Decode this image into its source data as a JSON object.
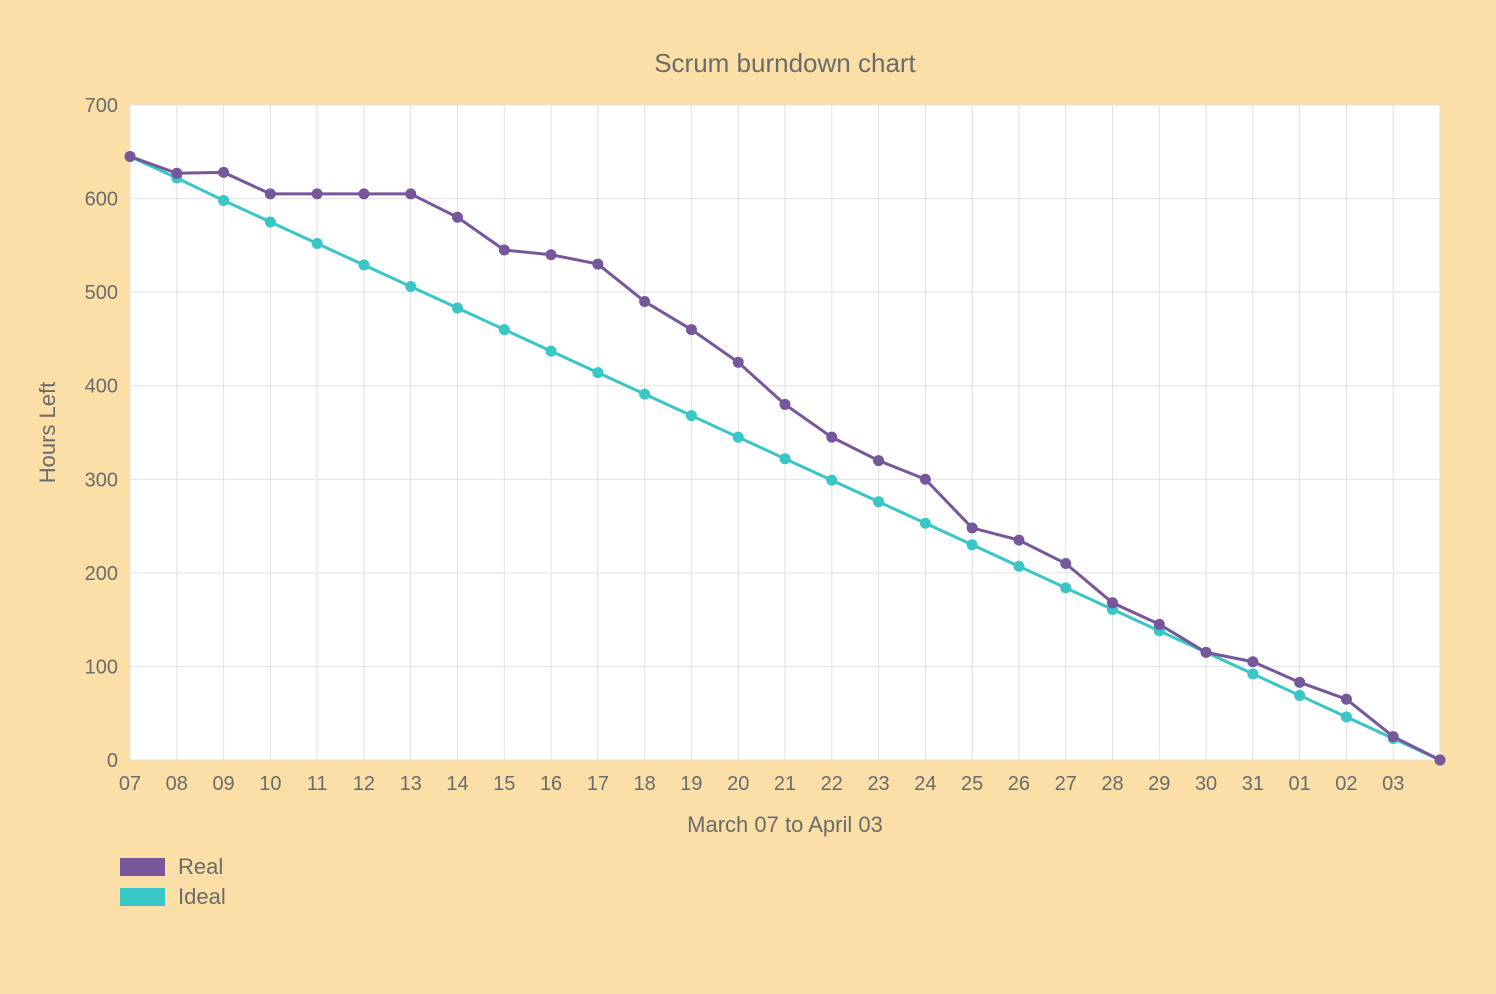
{
  "chart_data": {
    "type": "line",
    "title": "Scrum burndown chart",
    "xlabel": "March 07 to April 03",
    "ylabel": "Hours Left",
    "ylim": [
      0,
      700
    ],
    "yticks": [
      0,
      100,
      200,
      300,
      400,
      500,
      600,
      700
    ],
    "categories": [
      "07",
      "08",
      "09",
      "10",
      "11",
      "12",
      "13",
      "14",
      "15",
      "16",
      "17",
      "18",
      "19",
      "20",
      "21",
      "22",
      "23",
      "24",
      "25",
      "26",
      "27",
      "28",
      "29",
      "30",
      "31",
      "01",
      "02",
      "03",
      ""
    ],
    "series": [
      {
        "name": "Real",
        "color": "#77579b",
        "values": [
          645,
          627,
          628,
          605,
          605,
          605,
          605,
          580,
          545,
          540,
          530,
          490,
          460,
          425,
          380,
          345,
          320,
          300,
          248,
          235,
          210,
          168,
          145,
          115,
          105,
          83,
          65,
          25,
          0
        ]
      },
      {
        "name": "Ideal",
        "color": "#38c6c6",
        "values": [
          645,
          622,
          598,
          575,
          552,
          529,
          506,
          483,
          460,
          437,
          414,
          391,
          368,
          345,
          322,
          299,
          276,
          253,
          230,
          207,
          184,
          161,
          138,
          115,
          92,
          69,
          46,
          23,
          0
        ]
      }
    ],
    "legend": {
      "items": [
        {
          "label": "Real",
          "color": "#77579b"
        },
        {
          "label": "Ideal",
          "color": "#38c6c6"
        }
      ]
    }
  }
}
